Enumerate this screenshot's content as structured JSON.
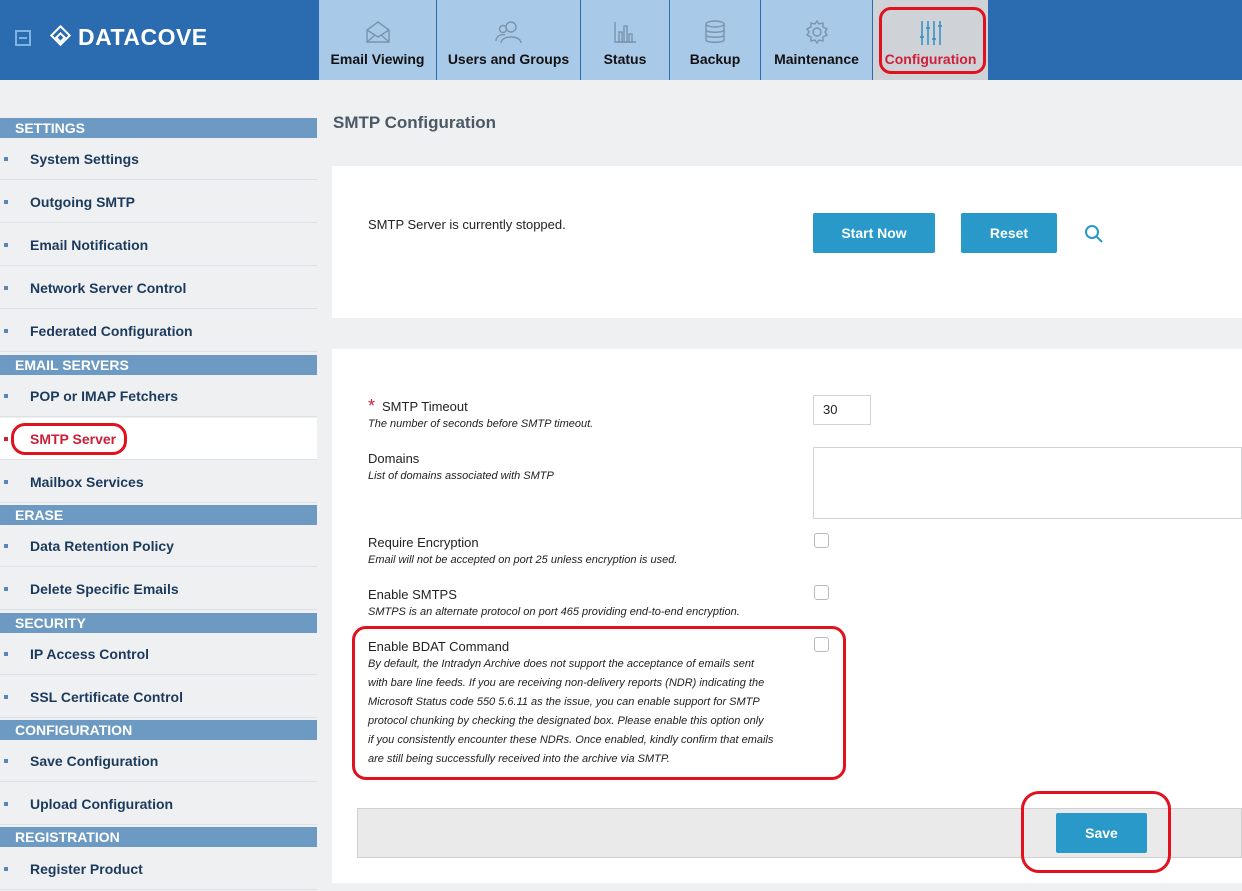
{
  "brand": {
    "name": "DATACOVE"
  },
  "tabs": [
    {
      "label": "Email Viewing",
      "icon": "envelope-icon"
    },
    {
      "label": "Users and Groups",
      "icon": "users-icon"
    },
    {
      "label": "Status",
      "icon": "bar-chart-icon"
    },
    {
      "label": "Backup",
      "icon": "database-icon"
    },
    {
      "label": "Maintenance",
      "icon": "gear-icon"
    },
    {
      "label": "Configuration",
      "icon": "sliders-icon",
      "active": true
    }
  ],
  "sidebar": {
    "settings": {
      "title": "SETTINGS",
      "items": [
        "System Settings",
        "Outgoing SMTP",
        "Email Notification",
        "Network Server Control",
        "Federated Configuration"
      ]
    },
    "email_servers": {
      "title": "EMAIL SERVERS",
      "items": [
        "POP or IMAP Fetchers",
        "SMTP Server",
        "Mailbox Services"
      ]
    },
    "erase": {
      "title": "ERASE",
      "items": [
        "Data Retention Policy",
        "Delete Specific Emails"
      ]
    },
    "security": {
      "title": "SECURITY",
      "items": [
        "IP Access Control",
        "SSL Certificate Control"
      ]
    },
    "configuration": {
      "title": "CONFIGURATION",
      "items": [
        "Save Configuration",
        "Upload Configuration"
      ]
    },
    "registration": {
      "title": "REGISTRATION",
      "items": [
        "Register Product"
      ]
    },
    "active_item": "SMTP Server"
  },
  "main": {
    "title": "SMTP Configuration",
    "status_text": "SMTP Server is currently stopped.",
    "start_button": "Start Now",
    "reset_button": "Reset",
    "fields": {
      "timeout": {
        "required_mark": "*",
        "label": "SMTP Timeout",
        "desc": "The number of seconds before SMTP timeout.",
        "value": "30"
      },
      "domains": {
        "label": "Domains",
        "desc": "List of domains associated with SMTP",
        "value": ""
      },
      "encryption": {
        "label": "Require Encryption",
        "desc": "Email will not be accepted on port 25 unless encryption is used.",
        "checked": false
      },
      "smtps": {
        "label": "Enable SMTPS",
        "desc": "SMTPS is an alternate protocol on port 465 providing end-to-end encryption.",
        "checked": false
      },
      "bdat": {
        "label": "Enable BDAT Command",
        "desc_lines": [
          "By default, the Intradyn Archive does not support the acceptance of emails sent",
          "with bare line feeds. If you are receiving non-delivery reports (NDR) indicating the",
          "Microsoft Status code 550 5.6.11 as the issue, you can enable support for SMTP",
          "protocol chunking by checking the designated box. Please enable this option only",
          "if you consistently encounter these NDRs. Once enabled, kindly confirm that emails",
          "are still being successfully received into the archive via SMTP."
        ],
        "checked": false
      }
    },
    "save_button": "Save"
  },
  "colors": {
    "header": "#2b6bb0",
    "tab": "#a9c9e8",
    "accent_button": "#2899c8",
    "highlight": "#e0121f",
    "active_text": "#d11f39",
    "section_header": "#6d9ac2"
  }
}
